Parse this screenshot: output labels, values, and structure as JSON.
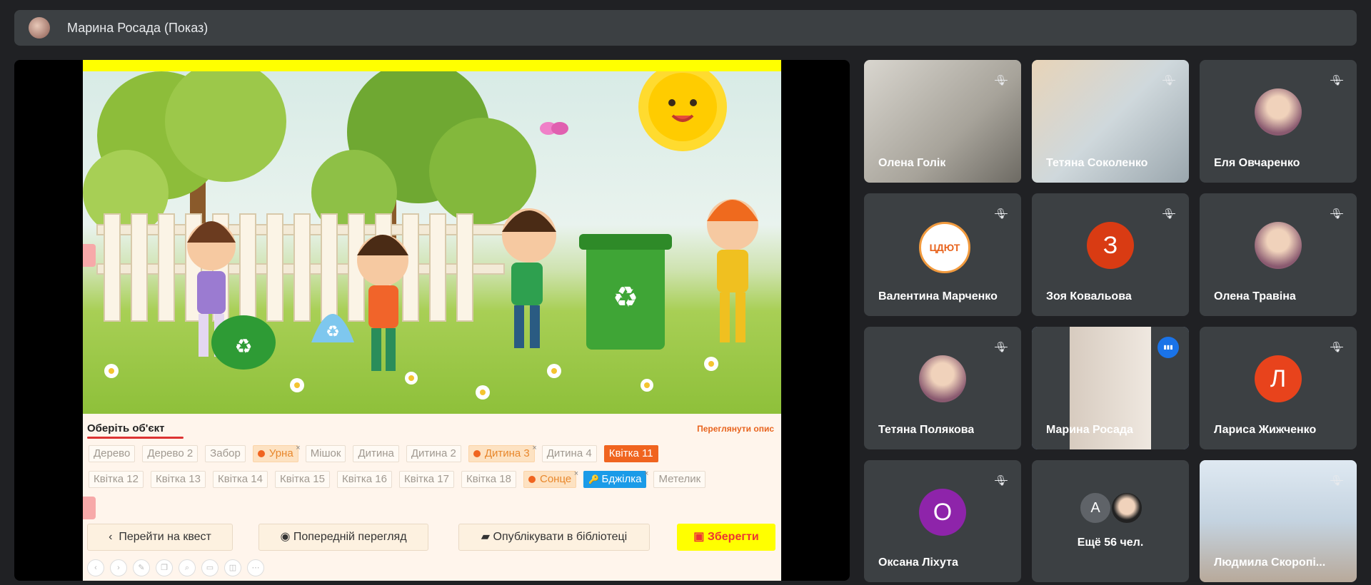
{
  "header": {
    "presenter_title": "Марина Росада (Показ)"
  },
  "slide": {
    "heading": "Оберіть об'єкт",
    "view_description": "Переглянути опис",
    "objects_row1": [
      {
        "label": "Дерево",
        "state": "normal"
      },
      {
        "label": "Дерево 2",
        "state": "normal"
      },
      {
        "label": "Забор",
        "state": "normal"
      },
      {
        "label": "Урна",
        "state": "selected"
      },
      {
        "label": "Мішок",
        "state": "normal"
      },
      {
        "label": "Дитина",
        "state": "normal"
      },
      {
        "label": "Дитина 2",
        "state": "normal"
      },
      {
        "label": "Дитина 3",
        "state": "selected"
      },
      {
        "label": "Дитина 4",
        "state": "normal"
      },
      {
        "label": "Квітка 11",
        "state": "active"
      }
    ],
    "objects_row2": [
      {
        "label": "Квітка 12",
        "state": "normal"
      },
      {
        "label": "Квітка 13",
        "state": "normal"
      },
      {
        "label": "Квітка 14",
        "state": "normal"
      },
      {
        "label": "Квітка 15",
        "state": "normal"
      },
      {
        "label": "Квітка 16",
        "state": "normal"
      },
      {
        "label": "Квітка 17",
        "state": "normal"
      },
      {
        "label": "Квітка 18",
        "state": "normal"
      },
      {
        "label": "Сонце",
        "state": "selected"
      },
      {
        "label": "Бджілка",
        "state": "blue"
      },
      {
        "label": "Метелик",
        "state": "normal"
      }
    ],
    "buttons": {
      "quest": "Перейти на квест",
      "preview": "Попередній перегляд",
      "publish": "Опублікувати в бібліотеці",
      "save": "Зберегти"
    }
  },
  "participants": [
    {
      "name": "Олена Голік",
      "type": "photo"
    },
    {
      "name": "Тетяна Соколенко",
      "type": "photo"
    },
    {
      "name": "Еля Овчаренко",
      "type": "avatar-photo"
    },
    {
      "name": "Валентина Марченко",
      "type": "logo"
    },
    {
      "name": "Зоя Ковальова",
      "type": "initial",
      "initial": "З",
      "color": "#d93b13"
    },
    {
      "name": "Олена Травіна",
      "type": "avatar-photo"
    },
    {
      "name": "Тетяна Полякова",
      "type": "avatar-photo"
    },
    {
      "name": "Марина Росада",
      "type": "photo",
      "speaking": true
    },
    {
      "name": "Лариса Жижченко",
      "type": "initial",
      "initial": "Л",
      "color": "#e8431c"
    },
    {
      "name": "Оксана Ліхута",
      "type": "initial",
      "initial": "О",
      "color": "#8e24aa"
    },
    {
      "name": "Ещё 56 чел.",
      "type": "more",
      "initial": "А"
    },
    {
      "name": "Людмила Скоропі...",
      "type": "photo"
    }
  ],
  "logo_text": "ЦДЮТ"
}
